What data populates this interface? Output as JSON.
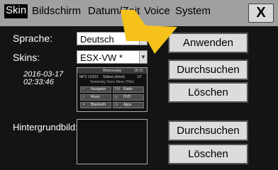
{
  "tabs": {
    "skin": "Skin",
    "bildschirm": "Bildschirm",
    "datum_zeit": "Datum/Zeit",
    "voice": "Voice",
    "system": "System",
    "active": "Skin"
  },
  "close": {
    "label": "X"
  },
  "settings": {
    "sprache_label": "Sprache:",
    "sprache_value": "Deutsch",
    "skins_label": "Skins:",
    "skins_value": "ESX-VW *",
    "skin_date": "2016-03-17",
    "skin_time": "02:33:46",
    "hintergrund_label": "Hintergrundbild:"
  },
  "skin_preview": {
    "day": "Wednesday",
    "time": "18:15",
    "track": "MP3 12/321",
    "artist": "Stiliam (Artist)",
    "temp": "13°",
    "song": "Yesterday Once More (Title)",
    "buttons": [
      {
        "icon": "□",
        "label": "Navigator"
      },
      {
        "icon": "FM",
        "label": "Radio"
      },
      {
        "icon": "♫",
        "label": "Music"
      },
      {
        "icon": "◎",
        "label": "DVD"
      },
      {
        "icon": "✦",
        "label": "Bluetooth"
      },
      {
        "icon": "☷",
        "label": "Apps"
      }
    ]
  },
  "buttons": {
    "anwenden": "Anwenden",
    "durchsuchen": "Durchsuchen",
    "loeschen": "Löschen"
  },
  "colors": {
    "tabbar": "#a0a0a0",
    "background": "#141414",
    "pointer": "#f6c21a",
    "button": "#dcdcdc"
  }
}
